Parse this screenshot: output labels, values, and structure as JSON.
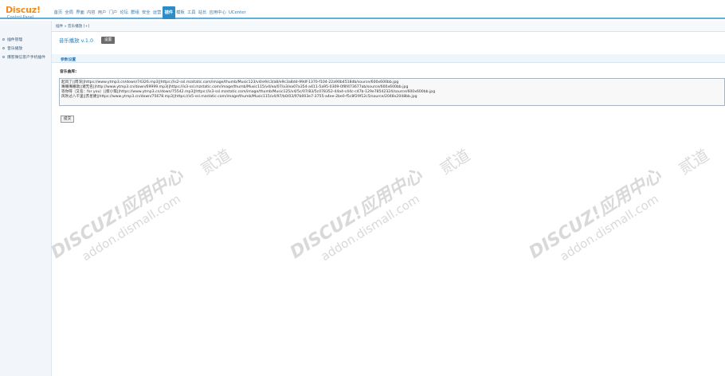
{
  "logo": {
    "title": "Discuz!",
    "subtitle": "Control Panel"
  },
  "nav": [
    {
      "label": "首页",
      "active": false
    },
    {
      "label": "全局",
      "active": false
    },
    {
      "label": "界面",
      "active": false
    },
    {
      "label": "内容",
      "active": false
    },
    {
      "label": "用户",
      "active": false
    },
    {
      "label": "门户",
      "active": false
    },
    {
      "label": "论坛",
      "active": false
    },
    {
      "label": "群组",
      "active": false
    },
    {
      "label": "安全",
      "active": false
    },
    {
      "label": "运营",
      "active": false
    },
    {
      "label": "插件",
      "active": true
    },
    {
      "label": "模板",
      "active": false
    },
    {
      "label": "工具",
      "active": false
    },
    {
      "label": "站长",
      "active": false
    },
    {
      "label": "应用中心",
      "active": false
    },
    {
      "label": "UCenter",
      "active": false
    }
  ],
  "sidebar": {
    "items": [
      {
        "label": "插件管理"
      },
      {
        "label": "音乐播放"
      },
      {
        "label": "爆客微信客户手机插件"
      }
    ]
  },
  "breadcrumb": "插件 » 音乐播放 [+]",
  "plugin": {
    "title": "音乐播放 v.1.0",
    "settings_label": "设置"
  },
  "section": {
    "title": "参数设置"
  },
  "form": {
    "music_label": "音乐曲库:",
    "music_lines": [
      "起风了||周深||https://www.ytmp3.cn/down/74326.mp3||https://is2-ssl.mzstatic.com/image/thumb/Music123/v4/e9/c3/a8/e9c3a8dd-99df-1370-f104-22a90b4518db/source/600x600bb.jpg",
      "嘴嘴嘴嘴歌||诸无名||http://www.ytmp3.cn/down/69999.mp3||https://is3-ssl.mzstatic.com/image/thumb/Music115/v4/ea/07/a3/ea07a354-a411-5a95-0309-0f8f473677ab/source/600x600bb.jpg",
      "等你呀（又名：for you）||蔡小琪||https://www.ytmp3.cn/down/75542.mp3||https://is3-ssl.mzstatic.com/image/thumb/Music125/v4/5c/07/83/5c078352-44a4-c44c-c47b-129e78542324/source/600x600bb.jpg",
      "风吹过八千里||苏星婕||https://www.ytmp3.cn/down/75678.mp3||https://is5-ssl.mzstatic.com/image/thumb/Music115/v4/97/b0/03/97b003e7-3755-a4ee-2be0-f5c8f29f12c5/source/2048x2048bb.jpg"
    ],
    "submit_label": "提交"
  },
  "watermark": {
    "brand": "DISCUZ!应用中心",
    "site": "addon.dismall.com",
    "mark": "贰道"
  },
  "colors": {
    "accent": "#2d8bc6",
    "logo": "#f08c1e",
    "link": "#1f7fbf"
  }
}
